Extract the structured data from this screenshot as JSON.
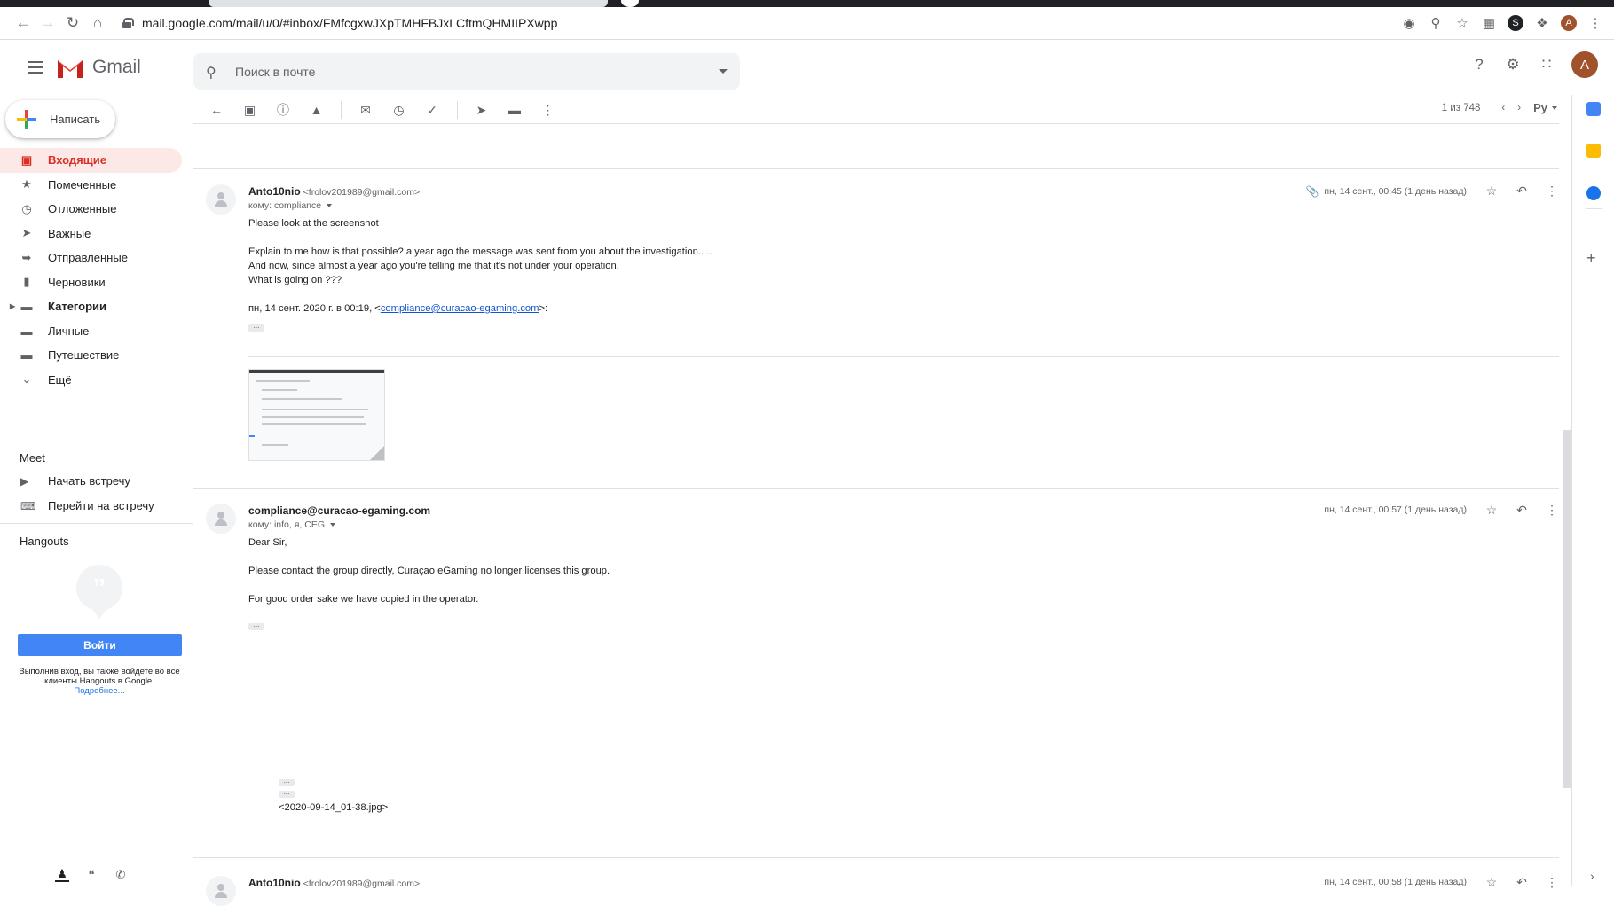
{
  "browser": {
    "url": "mail.google.com/mail/u/0/#inbox/FMfcgxwJXpTMHFBJxLCftmQHMIIPXwpp",
    "profile_initial": "A"
  },
  "app": {
    "name": "Gmail",
    "search_placeholder": "Поиск в почте",
    "avatar_initial": "A"
  },
  "sidebar": {
    "compose_label": "Написать",
    "items": [
      {
        "label": "Входящие",
        "icon": "inbox-icon"
      },
      {
        "label": "Помеченные",
        "icon": "star-icon"
      },
      {
        "label": "Отложенные",
        "icon": "clock-icon"
      },
      {
        "label": "Важные",
        "icon": "important-icon"
      },
      {
        "label": "Отправленные",
        "icon": "send-icon"
      },
      {
        "label": "Черновики",
        "icon": "draft-icon"
      },
      {
        "label": "Категории",
        "icon": "label-icon"
      },
      {
        "label": "Личные",
        "icon": "label-icon"
      },
      {
        "label": "Путешествие",
        "icon": "label-icon"
      },
      {
        "label": "Ещё",
        "icon": "chevron-down-icon"
      }
    ],
    "meet": {
      "title": "Meet",
      "start": "Начать встречу",
      "join": "Перейти на встречу"
    },
    "hangouts": {
      "title": "Hangouts",
      "signin": "Войти",
      "note": "Выполнив вход, вы также войдете во все клиенты Hangouts в Google.",
      "more": "Подробнее..."
    }
  },
  "toolbar": {
    "pagination": "1 из 748",
    "lang": "Ру"
  },
  "messages": [
    {
      "sender": "Anto10nio",
      "address": "<frolov201989@gmail.com>",
      "to": "кому: compliance",
      "date": "пн, 14 сент., 00:45 (1 день назад)",
      "lines": [
        "Please look at the screenshot",
        "",
        "Explain to me how is that possible? a year ago the message was sent from you about the investigation.....",
        "And now, since almost a year ago you're telling me that it's not under your operation.",
        "What is going on ???",
        ""
      ],
      "quote_prefix": "пн, 14 сент. 2020 г. в 00:19, <",
      "quote_link": "compliance@curacao-egaming.com",
      "quote_suffix": ">:"
    },
    {
      "sender": "compliance@curacao-egaming.com",
      "to": "кому: info, я, CEG",
      "date": "пн, 14 сент., 00:57 (1 день назад)",
      "lines": [
        "Dear Sir,",
        "",
        "Please contact the group directly, Curaçao eGaming no longer licenses this group.",
        "",
        "For good order sake we have copied in the operator."
      ],
      "attachment_text": "<2020-09-14_01-38.jpg>"
    },
    {
      "sender": "Anto10nio",
      "address": "<frolov201989@gmail.com>",
      "date": "пн, 14 сент., 00:58 (1 день назад)"
    }
  ]
}
